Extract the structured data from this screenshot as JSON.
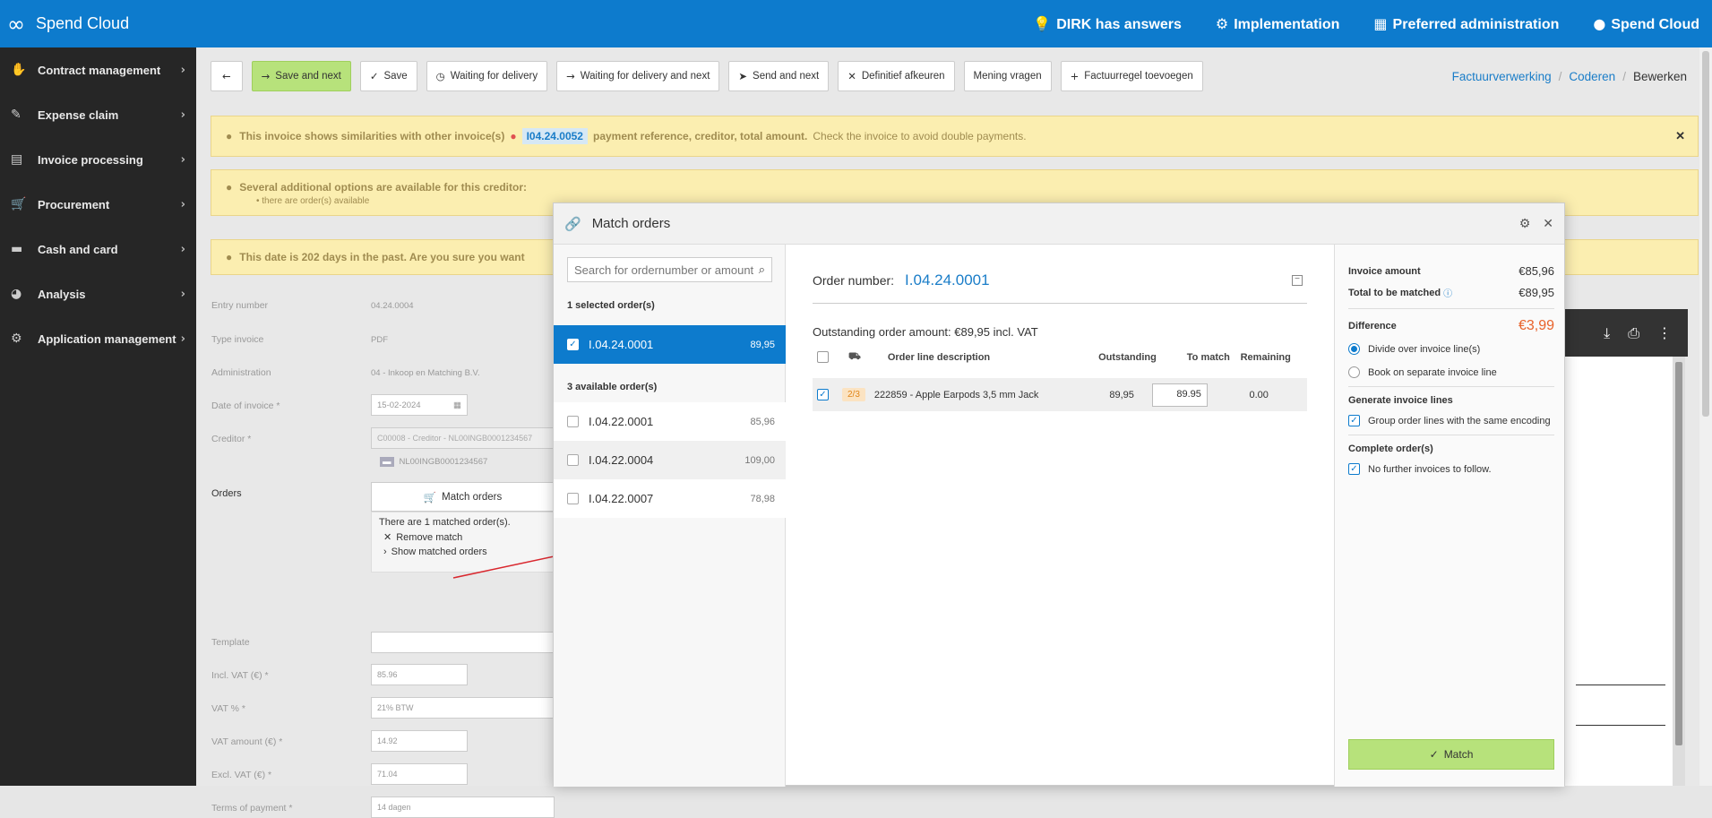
{
  "topbar": {
    "brand": "Spend Cloud",
    "nav": [
      {
        "icon": "lightbulb-icon",
        "label": "DIRK has answers"
      },
      {
        "icon": "cogs-icon",
        "label": "Implementation"
      },
      {
        "icon": "building-icon",
        "label": "Preferred administration"
      },
      {
        "icon": "user-circle-icon",
        "label": "Spend Cloud"
      }
    ]
  },
  "sidebar": {
    "items": [
      {
        "icon": "handshake-icon",
        "label": "Contract management"
      },
      {
        "icon": "pencil-icon",
        "label": "Expense claim"
      },
      {
        "icon": "file-icon",
        "label": "Invoice processing"
      },
      {
        "icon": "cart-icon",
        "label": "Procurement"
      },
      {
        "icon": "credit-card-icon",
        "label": "Cash and card"
      },
      {
        "icon": "pie-chart-icon",
        "label": "Analysis"
      },
      {
        "icon": "gear-icon",
        "label": "Application management"
      }
    ]
  },
  "toolbar": {
    "back": "",
    "save_next": "Save and next",
    "save": "Save",
    "waiting": "Waiting for delivery",
    "waiting_next": "Waiting for delivery and next",
    "send_next": "Send and next",
    "reject": "Definitief afkeuren",
    "opinion": "Mening vragen",
    "add_line": "Factuurregel toevoegen"
  },
  "breadcrumb": {
    "a": "Factuurverwerking",
    "b": "Coderen",
    "c": "Bewerken"
  },
  "alerts": {
    "similar_pre": "This invoice shows similarities with other invoice(s)",
    "similar_ref": "I04.24.0052",
    "similar_post": "payment reference, creditor, total amount.",
    "similar_tail": "Check the invoice to avoid double payments.",
    "options_title": "Several additional options are available for this creditor:",
    "options_item": "there are order(s) available",
    "date": "This date is 202 days in the past. Are you sure you want"
  },
  "form": {
    "labels": [
      "Entry number",
      "Type invoice",
      "Administration",
      "Date of invoice *",
      "Creditor *"
    ],
    "values": [
      "04.24.0004",
      "PDF",
      "04 - Inkoop en Matching B.V.",
      "15-02-2024",
      "C00008 - Creditor - NL00INGB0001234567",
      "NL00INGB0001234567"
    ],
    "orders_label": "Orders",
    "match_orders": "Match orders",
    "matched_text": "There are 1 matched order(s).",
    "remove_match": "Remove match",
    "show_matched": "Show matched orders",
    "lower_labels": [
      "Template",
      "Incl. VAT (€) *",
      "VAT % *",
      "VAT amount (€) *",
      "Excl. VAT (€) *",
      "Terms of payment *"
    ],
    "lower_values": [
      "",
      "85.96",
      "21% BTW",
      "14.92",
      "71.04",
      "14 dagen"
    ]
  },
  "modal": {
    "title": "Match orders",
    "search_placeholder": "Search for ordernumber or amount",
    "selected_header": "1 selected order(s)",
    "selected": [
      {
        "num": "I.04.24.0001",
        "amount": "89,95"
      }
    ],
    "available_header": "3 available order(s)",
    "available": [
      {
        "num": "I.04.22.0001",
        "amount": "85,96"
      },
      {
        "num": "I.04.22.0004",
        "amount": "109,00"
      },
      {
        "num": "I.04.22.0007",
        "amount": "78,98"
      }
    ],
    "order_label": "Order number:",
    "order_number": "I.04.24.0001",
    "outstanding_text": "Outstanding order amount: €89,95 incl. VAT",
    "columns": {
      "desc": "Order line description",
      "outstanding": "Outstanding",
      "to_match": "To match",
      "remaining": "Remaining"
    },
    "line": {
      "badge": "2/3",
      "desc": "222859 - Apple Earpods 3,5 mm Jack",
      "outstanding": "89,95",
      "to_match": "89.95",
      "remaining": "0.00"
    },
    "summary": {
      "invoice_amount_label": "Invoice amount",
      "invoice_amount": "€85,96",
      "total_label": "Total to be matched",
      "total": "€89,95",
      "difference_label": "Difference",
      "difference": "€3,99",
      "divide": "Divide over invoice line(s)",
      "book": "Book on separate invoice line",
      "gen_title": "Generate invoice lines",
      "group": "Group order lines with the same encoding",
      "complete_title": "Complete order(s)",
      "no_further": "No further invoices to follow.",
      "match_button": "Match"
    }
  },
  "colors": {
    "brand": "#0d7bcd",
    "accent_green": "#b7e27b",
    "difference": "#e8622a"
  }
}
